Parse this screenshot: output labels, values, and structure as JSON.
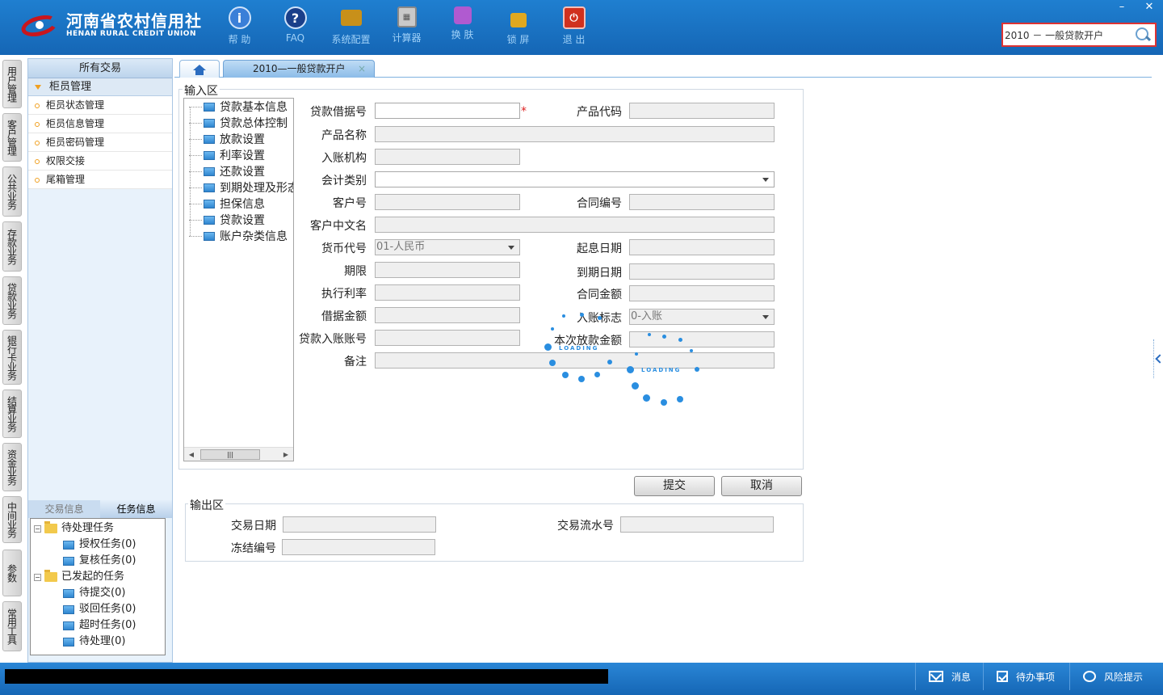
{
  "app": {
    "logo_cn": "河南省农村信用社",
    "logo_en": "HENAN RURAL CREDIT UNION"
  },
  "toolbar": [
    {
      "label": "帮 助",
      "icon": "info-icon"
    },
    {
      "label": "FAQ",
      "icon": "question-icon"
    },
    {
      "label": "系统配置",
      "icon": "toolbox-icon"
    },
    {
      "label": "计算器",
      "icon": "calculator-icon"
    },
    {
      "label": "换 肤",
      "icon": "shirt-icon"
    },
    {
      "label": "锁 屏",
      "icon": "lock-icon"
    },
    {
      "label": "退 出",
      "icon": "power-icon"
    }
  ],
  "search": {
    "value": "2010 － 一般贷款开户"
  },
  "vtabs": [
    "用户管理",
    "客户管理",
    "公共业务",
    "存款业务",
    "贷款业务",
    "银行卡业务",
    "结算业务",
    "资金业务",
    "中间业务",
    "参数",
    "常用工具"
  ],
  "left_panel": {
    "header": "所有交易",
    "group": "柜员管理",
    "items": [
      "柜员状态管理",
      "柜员信息管理",
      "柜员密码管理",
      "权限交接",
      "尾箱管理"
    ],
    "bottom_tabs": {
      "inactive": "交易信息",
      "active": "任务信息"
    },
    "task_tree": {
      "pending": {
        "label": "待处理任务",
        "children": [
          "授权任务(0)",
          "复核任务(0)"
        ]
      },
      "initiated": {
        "label": "已发起的任务",
        "children": [
          "待提交(0)",
          "驳回任务(0)",
          "超时任务(0)",
          "待处理(0)"
        ]
      }
    }
  },
  "tabs": {
    "current": "2010—一般贷款开户",
    "close": "×"
  },
  "input_area": {
    "legend": "输入区",
    "tree": [
      "贷款基本信息",
      "贷款总体控制",
      "放款设置",
      "利率设置",
      "还款设置",
      "到期处理及形态",
      "担保信息",
      "贷款设置",
      "账户杂类信息"
    ],
    "fields": {
      "loan_no": {
        "label": "贷款借据号",
        "value": ""
      },
      "product_code": {
        "label": "产品代码",
        "value": ""
      },
      "product_name": {
        "label": "产品名称",
        "value": ""
      },
      "account_org": {
        "label": "入账机构",
        "value": ""
      },
      "accounting_type": {
        "label": "会计类别",
        "value": ""
      },
      "customer_no": {
        "label": "客户号",
        "value": ""
      },
      "contract_no": {
        "label": "合同编号",
        "value": ""
      },
      "customer_cn_name": {
        "label": "客户中文名",
        "value": ""
      },
      "currency": {
        "label": "货币代号",
        "value": "01-人民币"
      },
      "start_date": {
        "label": "起息日期",
        "value": ""
      },
      "term": {
        "label": "期限",
        "value": ""
      },
      "due_date": {
        "label": "到期日期",
        "value": ""
      },
      "rate": {
        "label": "执行利率",
        "value": ""
      },
      "contract_amount": {
        "label": "合同金额",
        "value": ""
      },
      "loan_amount": {
        "label": "借据金额",
        "value": ""
      },
      "account_flag": {
        "label": "入账标志",
        "value": "0-入账"
      },
      "loan_account": {
        "label": "贷款入账账号",
        "value": ""
      },
      "this_amount": {
        "label": "本次放款金额",
        "value": ""
      },
      "remark": {
        "label": "备注",
        "value": ""
      }
    },
    "required_mark": "*"
  },
  "buttons": {
    "submit": "提交",
    "cancel": "取消"
  },
  "output_area": {
    "legend": "输出区",
    "fields": {
      "trade_date": {
        "label": "交易日期",
        "value": ""
      },
      "serial_no": {
        "label": "交易流水号",
        "value": ""
      },
      "freeze_no": {
        "label": "冻结编号",
        "value": ""
      }
    }
  },
  "loading_text": "LOADING",
  "statusbar": {
    "message": "消息",
    "todo": "待办事项",
    "risk": "风险提示"
  },
  "colors": {
    "header_blue": "#1566b5",
    "accent_red": "#d22"
  }
}
